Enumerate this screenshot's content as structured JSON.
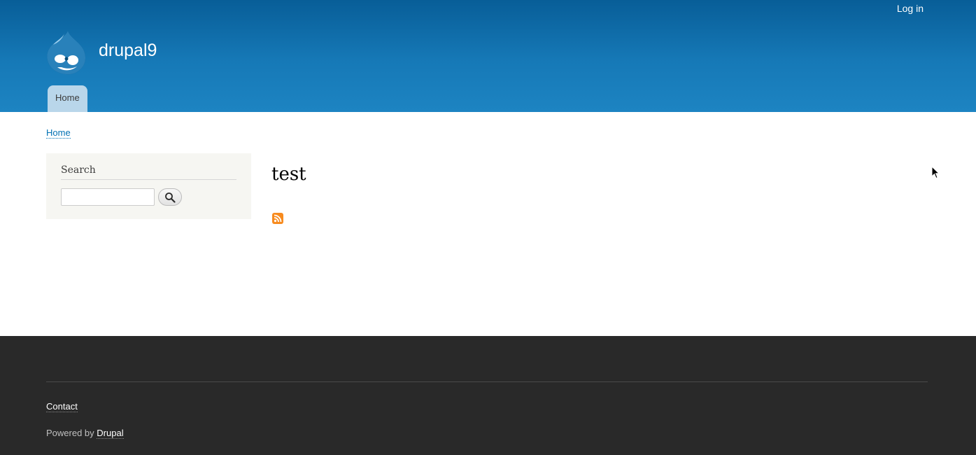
{
  "header": {
    "site_name": "drupal9",
    "login_label": "Log in",
    "main_menu": [
      {
        "label": "Home"
      }
    ]
  },
  "breadcrumb": {
    "label": "Home"
  },
  "sidebar": {
    "search_title": "Search",
    "search_value": "",
    "search_icon": "magnifier-icon"
  },
  "main": {
    "title": "test",
    "feed_icon": "rss-feed-icon"
  },
  "footer": {
    "contact_label": "Contact",
    "powered_prefix": "Powered by",
    "powered_link": "Drupal"
  },
  "colors": {
    "header_blue": "#1679b7",
    "menu_tab": "#b9d6ea",
    "link_blue": "#0071b3",
    "sidebar_bg": "#f6f6f2",
    "footer_bg": "#292929",
    "feed_orange": "#f78b1f"
  }
}
